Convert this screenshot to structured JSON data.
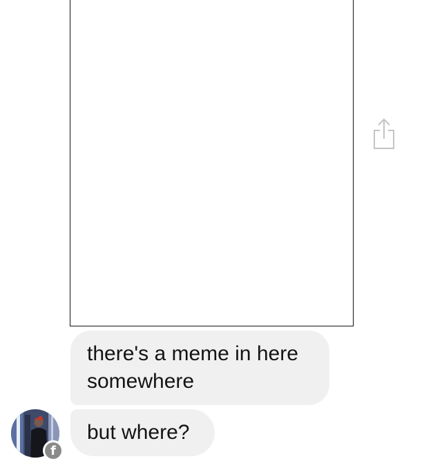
{
  "conversation": {
    "messages": [
      {
        "text": "there's a meme in here somewhere"
      },
      {
        "text": "but where?"
      }
    ]
  },
  "shared_image": {
    "content": "blank white image"
  },
  "icons": {
    "share": "share-icon",
    "avatar_badge": "facebook-badge-icon",
    "avatar_badge_glyph": "f"
  },
  "colors": {
    "bubble_background": "#f0f0f0",
    "message_text": "#141414",
    "share_icon": "#c4c4c4",
    "image_border": "#111111",
    "badge_background": "#8a8a8a"
  }
}
